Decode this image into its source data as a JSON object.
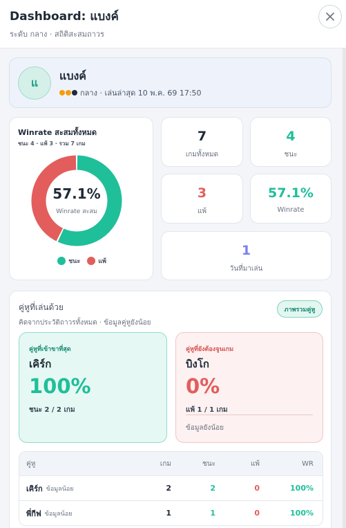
{
  "header": {
    "title": "Dashboard: แบงค์",
    "subtitle": "ระดับ กลาง · สถิติสะสมถาวร"
  },
  "profile": {
    "avatar_initial": "แ",
    "name": "แบงค์",
    "meta": "กลาง · เล่นล่าสุด 10 พ.ค. 69 17:50",
    "level_dots": [
      "#f59e0b",
      "#f59e0b",
      "#1f2937"
    ]
  },
  "winrate_card": {
    "title": "Winrate สะสมทั้งหมด",
    "subtitle": "ชนะ 4 · แพ้ 3 · รวม 7 เกม",
    "center_value": "57.1%",
    "center_label": "Winrate สะสม",
    "chart_data": {
      "type": "pie",
      "categories": [
        "ชนะ",
        "แพ้"
      ],
      "values": [
        4,
        3
      ],
      "colors": [
        "#1fbf9a",
        "#e35d5d"
      ],
      "legend_position": "bottom"
    },
    "legend": [
      {
        "label": "ชนะ",
        "color": "#1fbf9a"
      },
      {
        "label": "แพ้",
        "color": "#e35d5d"
      }
    ]
  },
  "stats": {
    "total_games": {
      "value": "7",
      "label": "เกมทั้งหมด",
      "color": "#1f2937"
    },
    "wins": {
      "value": "4",
      "label": "ชนะ",
      "color": "#1fbf9a"
    },
    "losses": {
      "value": "3",
      "label": "แพ้",
      "color": "#e35d5d"
    },
    "winrate": {
      "value": "57.1%",
      "label": "Winrate",
      "color": "#1fbf9a"
    },
    "days_played": {
      "value": "1",
      "label": "วันที่มาเล่น",
      "color": "#7b7ff0"
    }
  },
  "partners": {
    "title": "คู่หูที่เล่นด้วย",
    "subtitle": "คิดจากประวัติถาวรทั้งหมด · ข้อมูลคู่หูยังน้อย",
    "overview_button": "ภาพรวมคู่หู",
    "best": {
      "label": "คู่หูที่เข้าขาที่สุด",
      "name": "เคิร์ก",
      "pct": "100%",
      "record": "ชนะ 2 / 2 เกม"
    },
    "worst": {
      "label": "คู่หูที่ยังต้องจูนเกม",
      "name": "บิงโก",
      "pct": "0%",
      "record": "แพ้ 1 / 1 เกม",
      "note": "ข้อมูลยังน้อย"
    },
    "table": {
      "headers": {
        "name": "คู่หู",
        "games": "เกม",
        "wins": "ชนะ",
        "losses": "แพ้",
        "wr": "WR"
      },
      "rows": [
        {
          "name": "เคิร์ก",
          "tag": "ข้อมูลน้อย",
          "games": "2",
          "wins": "2",
          "losses": "0",
          "wr": "100%"
        },
        {
          "name": "พี่กีฟ",
          "tag": "ข้อมูลน้อย",
          "games": "1",
          "wins": "1",
          "losses": "0",
          "wr": "100%"
        }
      ]
    }
  },
  "colors": {
    "win": "#1fbf9a",
    "loss": "#e35d5d",
    "accent": "#1e9f87"
  }
}
